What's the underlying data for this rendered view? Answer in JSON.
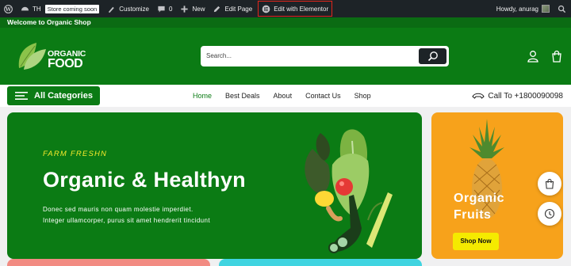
{
  "adminbar": {
    "site": "TH",
    "store_badge": "Store coming soon",
    "customize": "Customize",
    "comments_count": "0",
    "new": "New",
    "edit_page": "Edit Page",
    "edit_elementor": "Edit with Elementor",
    "howdy": "Howdy, anurag"
  },
  "welcome": "Welcome to Organic Shop",
  "logo": {
    "line1": "ORGANIC",
    "line2": "FOOD"
  },
  "search": {
    "placeholder": "Search..."
  },
  "nav": {
    "all_categories": "All Categories",
    "menu": [
      "Home",
      "Best Deals",
      "About",
      "Contact Us",
      "Shop"
    ],
    "call": "Call To +1800090098"
  },
  "hero": {
    "tagline": "FARM FRESHN",
    "title": "Organic & Healthyn",
    "desc_line1": "Donec sed mauris non quam molestie imperdiet.",
    "desc_line2": "Integer ullamcorper, purus sit amet hendrerit tincidunt"
  },
  "side_banner": {
    "title_line1": "Organic",
    "title_line2": "Fruits",
    "button": "Shop Now"
  },
  "colors": {
    "primary_green": "#0b7b14",
    "adminbar": "#1d2327",
    "accent_yellow": "#f5ea2b",
    "orange": "#f7a21b",
    "highlight_red": "#e1251b"
  }
}
